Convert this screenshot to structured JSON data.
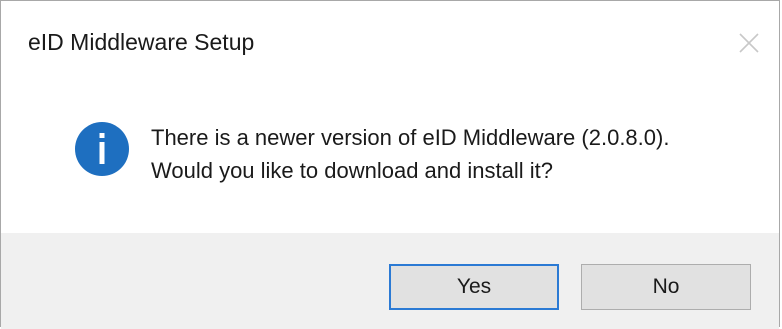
{
  "window": {
    "title": "eID Middleware Setup",
    "close_icon": "close-icon"
  },
  "message": {
    "icon": "info-icon",
    "line1": "There is a newer version of eID Middleware (2.0.8.0).",
    "line2": "Would you like to download and install it?"
  },
  "buttons": {
    "yes_label": "Yes",
    "no_label": "No"
  },
  "colors": {
    "info_icon": "#1e6fc0",
    "default_button_border": "#2b7ad4",
    "footer_background": "#f0f0f0",
    "button_background": "#e1e1e1"
  }
}
